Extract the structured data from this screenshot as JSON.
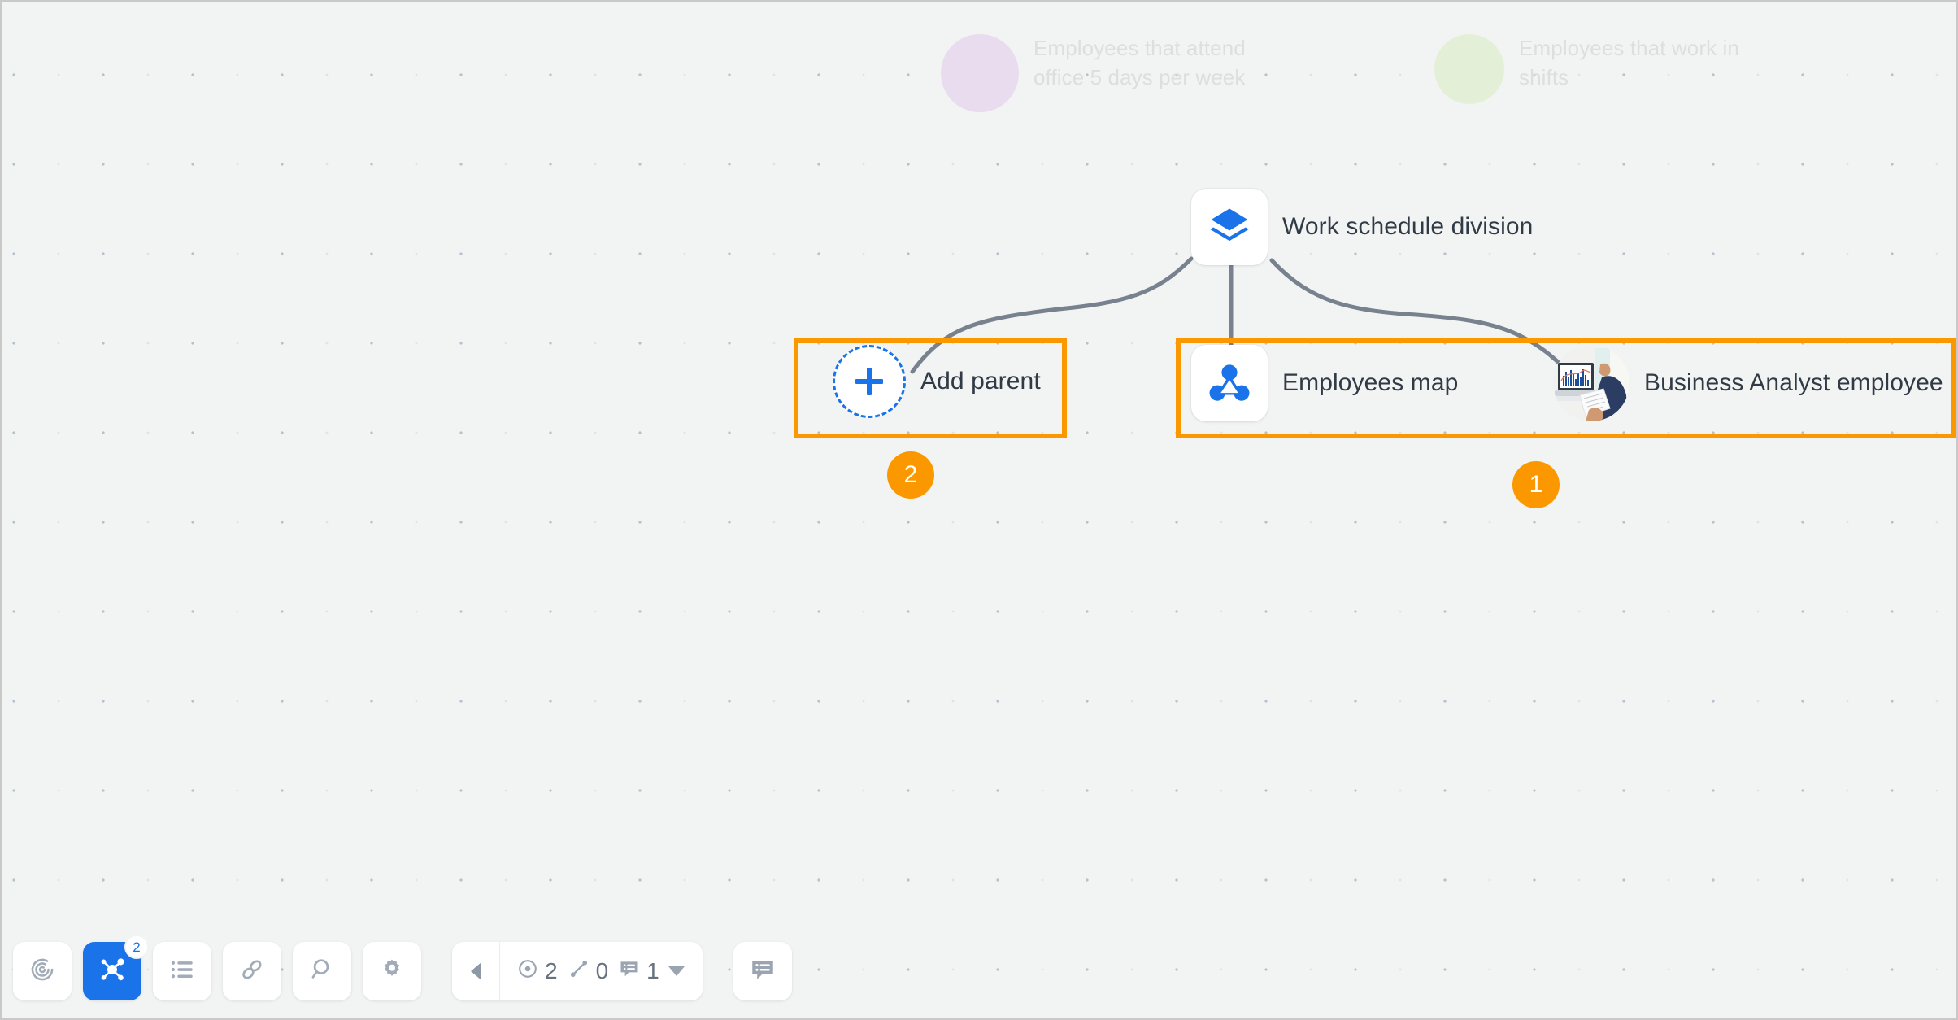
{
  "canvas": {
    "background_color": "#f2f3f3",
    "dot_color": "#b9c0cd",
    "edge_color": "#78828e",
    "accent_color": "#1a73e8",
    "annotation_color": "#fb9800"
  },
  "groups": [
    {
      "id": "purple",
      "label": "Employees that attend office 5 days per week",
      "bubble_color": "#e9dcef"
    },
    {
      "id": "green",
      "label": "Employees that work in shifts",
      "bubble_color": "#e4efd7"
    }
  ],
  "nodes": {
    "root": {
      "label": "Work schedule division",
      "icon": "layers-icon"
    },
    "employees_map": {
      "label": "Employees map",
      "icon": "org-network-icon"
    },
    "business_analyst": {
      "label": "Business Analyst employee",
      "icon": "person-photo-avatar"
    },
    "add_parent": {
      "label": "Add parent",
      "icon": "plus-icon"
    }
  },
  "annotations": [
    {
      "number": "1",
      "target": "employees-map-and-business-analyst-row"
    },
    {
      "number": "2",
      "target": "add-parent-node"
    }
  ],
  "toolbar": {
    "buttons": [
      {
        "name": "target-icon",
        "label": "",
        "active": false
      },
      {
        "name": "mindmap-icon",
        "label": "",
        "active": true,
        "badge": "2"
      },
      {
        "name": "list-icon",
        "label": "",
        "active": false
      },
      {
        "name": "link-icon",
        "label": "",
        "active": false
      },
      {
        "name": "search-icon",
        "label": "",
        "active": false
      },
      {
        "name": "gear-icon",
        "label": "",
        "active": false
      }
    ],
    "counters": {
      "collapse_icon": "caret-left-icon",
      "nodes_icon": "circle-dot-icon",
      "nodes_count": "2",
      "edges_icon": "edge-line-icon",
      "edges_count": "0",
      "comments_icon": "comment-list-icon",
      "comments_count": "1",
      "dropdown_icon": "caret-down-icon"
    },
    "comments_button": {
      "name": "comment-panel-icon",
      "label": ""
    }
  }
}
